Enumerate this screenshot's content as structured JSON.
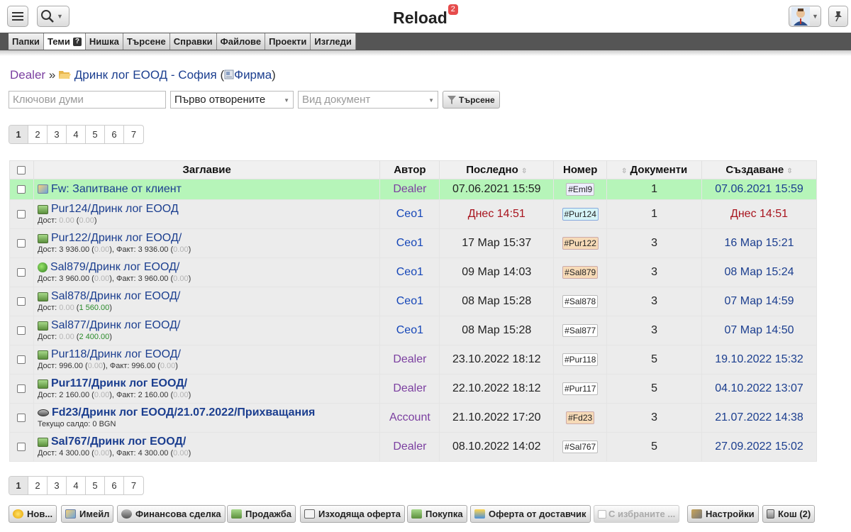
{
  "app": {
    "title": "Reload",
    "notifications": "2"
  },
  "nav": {
    "tabs": [
      {
        "label": "Папки"
      },
      {
        "label": "Теми",
        "help": "?"
      },
      {
        "label": "Нишка"
      },
      {
        "label": "Търсене"
      },
      {
        "label": "Справки"
      },
      {
        "label": "Файлове"
      },
      {
        "label": "Проекти"
      },
      {
        "label": "Изгледи"
      }
    ]
  },
  "breadcrumb": {
    "owner": "Dealer",
    "separator": "»",
    "company": "Дринк лог ЕООД - София",
    "type_open": "(",
    "type": "Фирма",
    "type_close": ")"
  },
  "filters": {
    "keywords_placeholder": "Ключови думи",
    "order_value": "Първо отворените",
    "doctype_placeholder": "Вид документ",
    "search_label": "Търсене"
  },
  "pager": {
    "pages": [
      "1",
      "2",
      "3",
      "4",
      "5",
      "6",
      "7"
    ],
    "current": "1"
  },
  "table": {
    "headers": {
      "title": "Заглавие",
      "author": "Автор",
      "last": "Последно",
      "number": "Номер",
      "documents": "Документи",
      "created": "Създаване"
    },
    "rows": [
      {
        "icon": "mail-icon",
        "title": "Fw: Запитване от клиент",
        "sub": [],
        "author": "Dealer",
        "last": "07.06.2021 15:59",
        "number": "#Eml9",
        "docs": "1",
        "created": "07.06.2021 15:59"
      },
      {
        "icon": "cart-icon",
        "title": "Pur124/Дринк лог ЕООД",
        "sub": [
          [
            "Дост: ",
            ""
          ],
          [
            "0.00",
            "mut"
          ],
          [
            " (",
            ""
          ],
          [
            "0.00",
            "mut"
          ],
          [
            ")",
            ""
          ]
        ],
        "author": "Ceo1",
        "last": "Днес 14:51",
        "number": "#Pur124",
        "docs": "1",
        "created": "Днес 14:51"
      },
      {
        "icon": "cart-icon",
        "title": "Pur122/Дринк лог ЕООД/",
        "sub": [
          [
            "Дост: 3 936.00 (",
            ""
          ],
          [
            "0.00",
            "mut"
          ],
          [
            "), Факт: 3 936.00 (",
            ""
          ],
          [
            "0.00",
            "mut"
          ],
          [
            ")",
            ""
          ]
        ],
        "author": "Ceo1",
        "last": "17 Мар 15:37",
        "number": "#Pur122",
        "docs": "3",
        "created": "16 Мар 15:21"
      },
      {
        "icon": "sale-icon",
        "title": "Sal879/Дринк лог ЕООД/",
        "sub": [
          [
            "Дост: 3 960.00 (",
            ""
          ],
          [
            "0.00",
            "mut"
          ],
          [
            "), Факт: 3 960.00 (",
            ""
          ],
          [
            "0.00",
            "mut"
          ],
          [
            ")",
            ""
          ]
        ],
        "author": "Ceo1",
        "last": "09 Мар 14:03",
        "number": "#Sal879",
        "docs": "3",
        "created": "08 Мар 15:24"
      },
      {
        "icon": "cart-icon",
        "title": "Sal878/Дринк лог ЕООД/",
        "sub": [
          [
            "Дост: ",
            ""
          ],
          [
            "0.00",
            "mut"
          ],
          [
            " (",
            ""
          ],
          [
            "1 560.00",
            "grn"
          ],
          [
            ")",
            ""
          ]
        ],
        "author": "Ceo1",
        "last": "08 Мар 15:28",
        "number": "#Sal878",
        "docs": "3",
        "created": "07 Мар 14:59"
      },
      {
        "icon": "cart-icon",
        "title": "Sal877/Дринк лог ЕООД/",
        "sub": [
          [
            "Дост: ",
            ""
          ],
          [
            "0.00",
            "mut"
          ],
          [
            " (",
            ""
          ],
          [
            "2 400.00",
            "grn"
          ],
          [
            ")",
            ""
          ]
        ],
        "author": "Ceo1",
        "last": "08 Мар 15:28",
        "number": "#Sal877",
        "docs": "3",
        "created": "07 Мар 14:50"
      },
      {
        "icon": "cart-icon",
        "title": "Pur118/Дринк лог ЕООД/",
        "sub": [
          [
            "Дост: 996.00 (",
            ""
          ],
          [
            "0.00",
            "mut"
          ],
          [
            "), Факт: 996.00 (",
            ""
          ],
          [
            "0.00",
            "mut"
          ],
          [
            ")",
            ""
          ]
        ],
        "author": "Dealer",
        "last": "23.10.2022 18:12",
        "number": "#Pur118",
        "docs": "5",
        "created": "19.10.2022 15:32"
      },
      {
        "icon": "cart-icon",
        "title": "Pur117/Дринк лог ЕООД/",
        "bold": true,
        "sub": [
          [
            "Дост: 2 160.00 (",
            ""
          ],
          [
            "0.00",
            "mut"
          ],
          [
            "), Факт: 2 160.00 (",
            ""
          ],
          [
            "0.00",
            "mut"
          ],
          [
            ")",
            ""
          ]
        ],
        "author": "Dealer",
        "last": "22.10.2022 18:12",
        "number": "#Pur117",
        "docs": "5",
        "created": "04.10.2022 13:07"
      },
      {
        "icon": "finance-icon",
        "title": "Fd23/Дринк лог ЕООД/21.07.2022/Прихващания",
        "bold": true,
        "sub": [
          [
            "Текущо салдо: 0 BGN",
            ""
          ]
        ],
        "author": "Account",
        "last": "21.10.2022 17:20",
        "number": "#Fd23",
        "docs": "3",
        "created": "21.07.2022 14:38"
      },
      {
        "icon": "cart-icon",
        "title": "Sal767/Дринк лог ЕООД/",
        "bold": true,
        "sub": [
          [
            "Дост: 4 300.00 (",
            ""
          ],
          [
            "0.00",
            "mut"
          ],
          [
            "), Факт: 4 300.00 (",
            ""
          ],
          [
            "0.00",
            "mut"
          ],
          [
            ")",
            ""
          ]
        ],
        "author": "Dealer",
        "last": "08.10.2022 14:02",
        "number": "#Sal767",
        "docs": "5",
        "created": "27.09.2022 15:02"
      }
    ]
  },
  "toolbar": {
    "new": "Нов...",
    "email": "Имейл",
    "finance": "Финансова сделка",
    "sale": "Продажба",
    "offer_out": "Изходяща оферта",
    "purchase": "Покупка",
    "offer_supplier": "Оферта от доставчик",
    "with_selected": "С избраните ...",
    "settings": "Настройки",
    "trash": "Кош (2)"
  },
  "colors": {
    "highlight_row": "#b6f5b9",
    "link": "#1b3e8f",
    "dealer": "#7b3fa0",
    "today": "#a8141e",
    "nav_bar": "#555555"
  }
}
